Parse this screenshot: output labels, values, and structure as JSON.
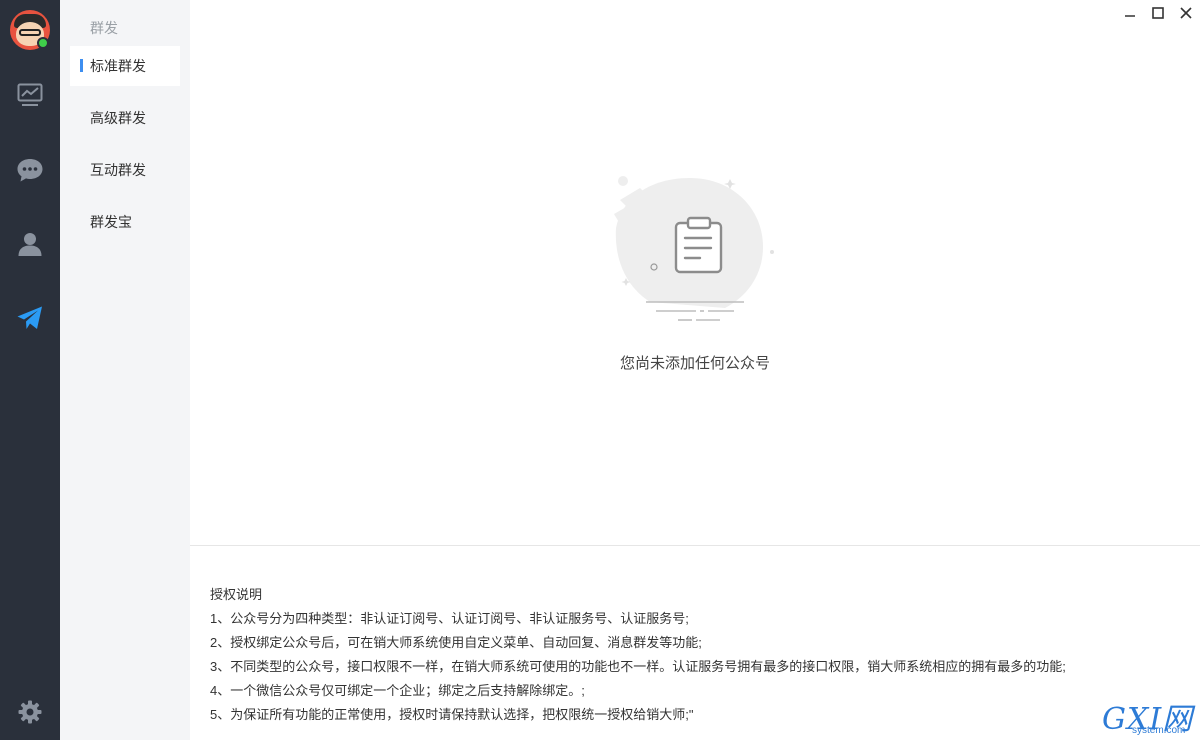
{
  "subnav": {
    "title": "群发",
    "items": [
      {
        "label": "标准群发",
        "active": true
      },
      {
        "label": "高级群发",
        "active": false
      },
      {
        "label": "互动群发",
        "active": false
      },
      {
        "label": "群发宝",
        "active": false
      }
    ]
  },
  "rail": {
    "icons": [
      "chart-icon",
      "chat-bubble-icon",
      "user-icon",
      "send-paper-plane-icon",
      "gear-icon"
    ],
    "active": "send-paper-plane-icon",
    "active_color": "#2b9bf4"
  },
  "window_controls": [
    "minimize",
    "maximize",
    "close"
  ],
  "empty_state": {
    "message": "您尚未添加任何公众号",
    "icon": "clipboard-icon"
  },
  "auth_notes": {
    "title": "授权说明",
    "lines": [
      "1、公众号分为四种类型：非认证订阅号、认证订阅号、非认证服务号、认证服务号;",
      "2、授权绑定公众号后，可在销大师系统使用自定义菜单、自动回复、消息群发等功能;",
      "3、不同类型的公众号，接口权限不一样，在销大师系统可使用的功能也不一样。认证服务号拥有最多的接口权限，销大师系统相应的拥有最多的功能;",
      "4、一个微信公众号仅可绑定一个企业；绑定之后支持解除绑定。;",
      "5、为保证所有功能的正常使用，授权时请保持默认选择，把权限统一授权给销大师;\""
    ]
  },
  "watermark": {
    "main": "GXI网",
    "sub": "system.com"
  },
  "colors": {
    "rail_bg": "#2a303b",
    "subnav_bg": "#f4f5f7",
    "accent": "#3d8ef0"
  }
}
